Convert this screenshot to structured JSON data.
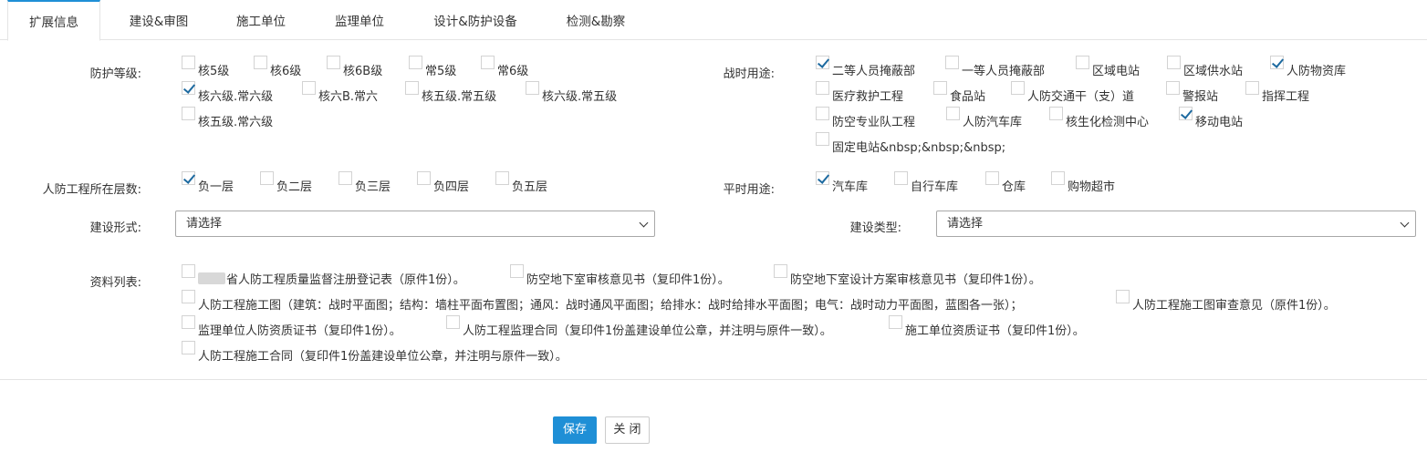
{
  "tabs": [
    "扩展信息",
    "建设&审图",
    "施工单位",
    "监理单位",
    "设计&防护设备",
    "检测&勘察"
  ],
  "labels": {
    "protection_level": "防护等级:",
    "wartime_use": "战时用途:",
    "floor": "人防工程所在层数:",
    "peacetime_use": "平时用途:",
    "build_form": "建设形式:",
    "build_type": "建设类型:",
    "materials": "资料列表:"
  },
  "protection_levels": [
    {
      "label": "核5级",
      "checked": false
    },
    {
      "label": "核6级",
      "checked": false
    },
    {
      "label": "核6B级",
      "checked": false
    },
    {
      "label": "常5级",
      "checked": false
    },
    {
      "label": "常6级",
      "checked": false
    },
    {
      "label": "核六级.常六级",
      "checked": true
    },
    {
      "label": "核六B.常六",
      "checked": false
    },
    {
      "label": "核五级.常五级",
      "checked": false
    },
    {
      "label": "核六级.常五级",
      "checked": false
    },
    {
      "label": "核五级.常六级",
      "checked": false
    }
  ],
  "wartime_uses": [
    {
      "label": "二等人员掩蔽部",
      "checked": true
    },
    {
      "label": "一等人员掩蔽部",
      "checked": false
    },
    {
      "label": "区域电站",
      "checked": false
    },
    {
      "label": "区域供水站",
      "checked": false
    },
    {
      "label": "人防物资库",
      "checked": true
    },
    {
      "label": "医疗救护工程",
      "checked": false
    },
    {
      "label": "食品站",
      "checked": false
    },
    {
      "label": "人防交通干（支）道",
      "checked": false
    },
    {
      "label": "警报站",
      "checked": false
    },
    {
      "label": "指挥工程",
      "checked": false
    },
    {
      "label": "防空专业队工程",
      "checked": false
    },
    {
      "label": "人防汽车库",
      "checked": false
    },
    {
      "label": "核生化检测中心",
      "checked": false
    },
    {
      "label": "移动电站",
      "checked": true
    },
    {
      "label": "固定电站&nbsp;&nbsp;&nbsp;",
      "checked": false
    }
  ],
  "floors": [
    {
      "label": "负一层",
      "checked": true
    },
    {
      "label": "负二层",
      "checked": false
    },
    {
      "label": "负三层",
      "checked": false
    },
    {
      "label": "负四层",
      "checked": false
    },
    {
      "label": "负五层",
      "checked": false
    }
  ],
  "peacetime_uses": [
    {
      "label": "汽车库",
      "checked": true
    },
    {
      "label": "自行车库",
      "checked": false
    },
    {
      "label": "仓库",
      "checked": false
    },
    {
      "label": "购物超市",
      "checked": false
    }
  ],
  "build_form_value": "请选择",
  "build_type_value": "请选择",
  "materials": [
    {
      "label": "省人防工程质量监督注册登记表（原件1份）。",
      "checked": false
    },
    {
      "label": "防空地下室审核意见书（复印件1份）。",
      "checked": false
    },
    {
      "label": "防空地下室设计方案审核意见书（复印件1份）。",
      "checked": false
    },
    {
      "label": "人防工程施工图（建筑：战时平面图；结构：墙柱平面布置图；通风：战时通风平面图；给排水：战时给排水平面图；电气：战时动力平面图，蓝图各一张）；",
      "checked": false
    },
    {
      "label": "人防工程施工图审查意见（原件1份）。",
      "checked": false
    },
    {
      "label": "监理单位人防资质证书（复印件1份）。",
      "checked": false
    },
    {
      "label": "人防工程监理合同（复印件1份盖建设单位公章，并注明与原件一致）。",
      "checked": false
    },
    {
      "label": "施工单位资质证书（复印件1份）。",
      "checked": false
    },
    {
      "label": "人防工程施工合同（复印件1份盖建设单位公章，并注明与原件一致）。",
      "checked": false
    }
  ],
  "buttons": {
    "save": "保存",
    "close": "关 闭"
  }
}
